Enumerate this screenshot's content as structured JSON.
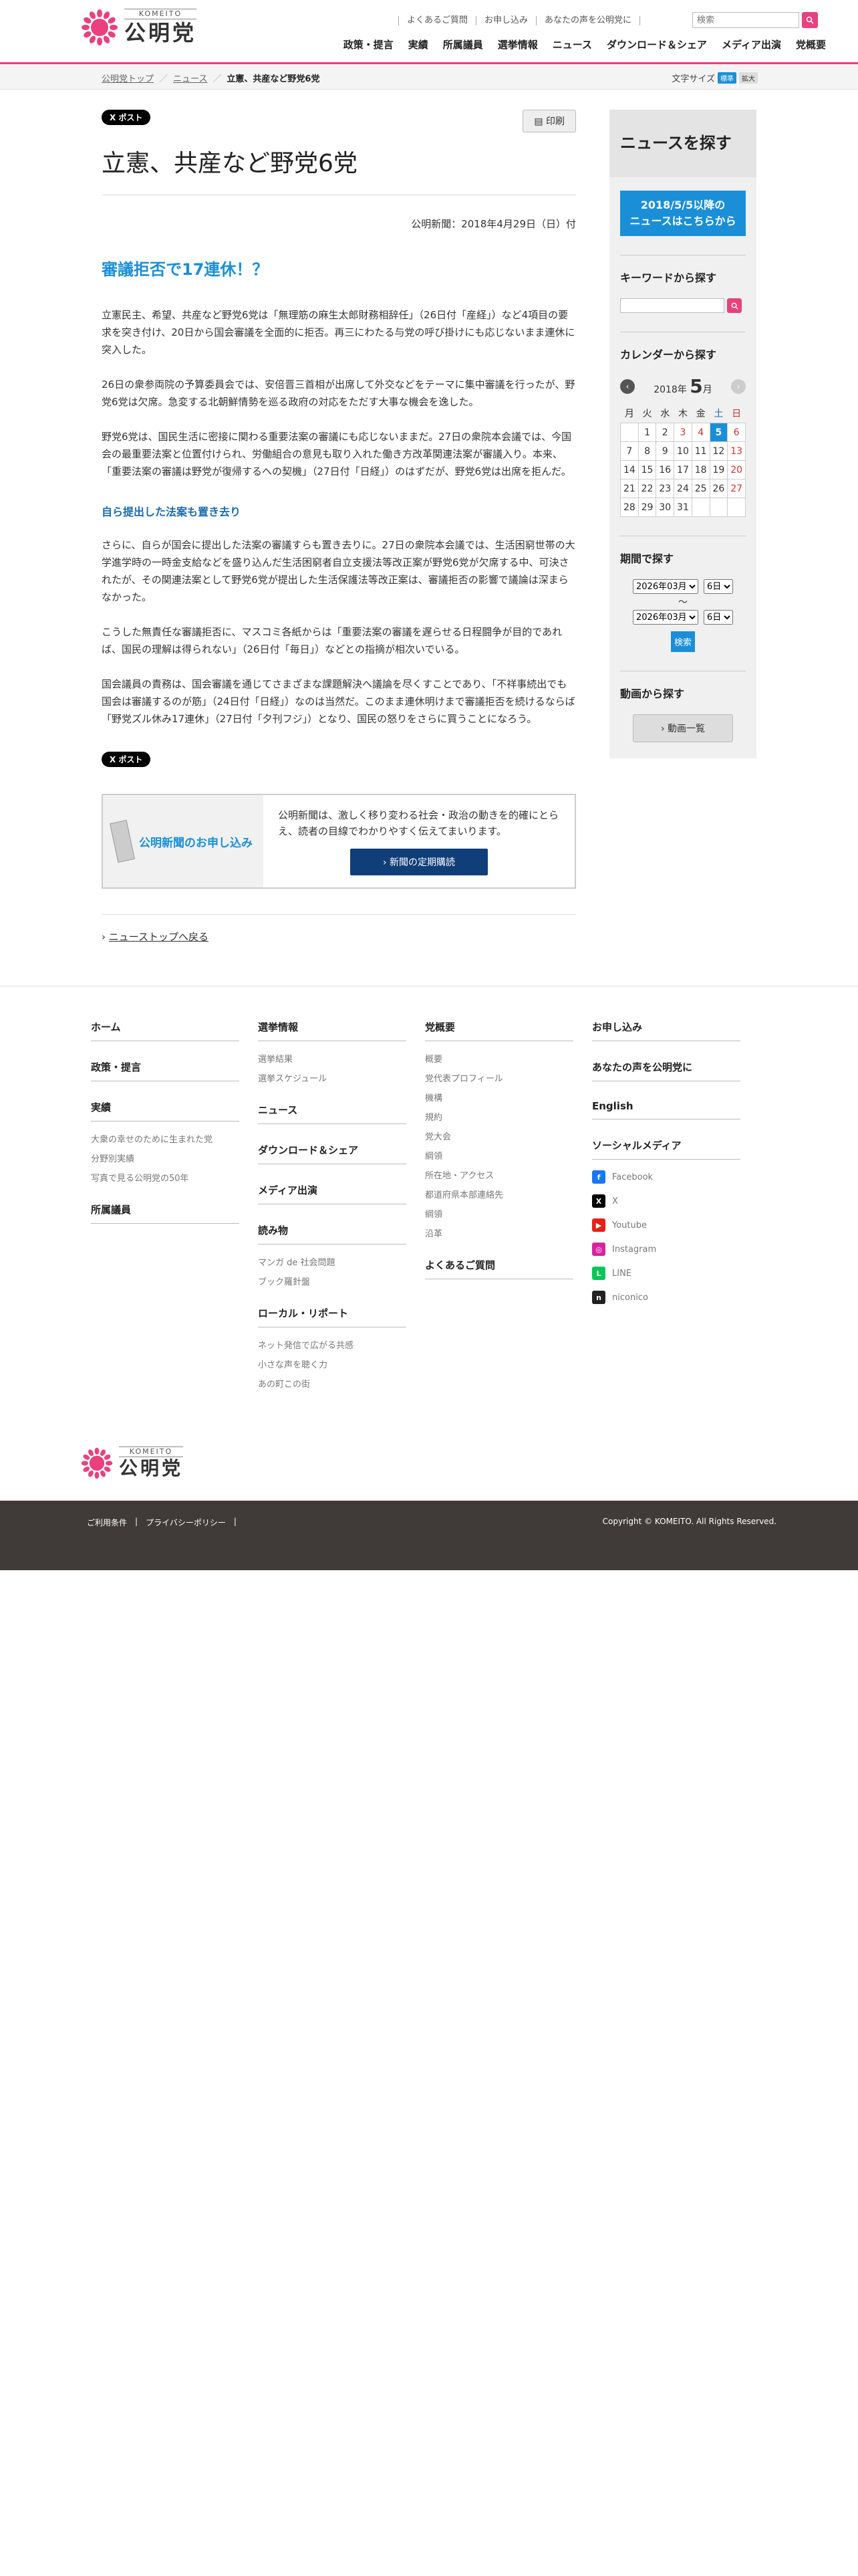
{
  "header": {
    "logo_sub": "KOMEITO",
    "logo_main": "公明党",
    "util_links": [
      "よくあるご質問",
      "お申し込み",
      "あなたの声を公明党に"
    ],
    "search_placeholder": "検索",
    "nav": [
      "政策・提言",
      "実績",
      "所属議員",
      "選挙情報",
      "ニュース",
      "ダウンロード＆シェア",
      "メディア出演",
      "党概要"
    ]
  },
  "breadcrumb": {
    "items": [
      "公明党トップ",
      "ニュース"
    ],
    "current": "立憲、共産など野党6党"
  },
  "fontsize": {
    "label": "文字サイズ",
    "normal": "標準",
    "large": "拡大"
  },
  "article": {
    "tweet": "X ポスト",
    "print": "印刷",
    "title": "立憲、共産など野党6党",
    "date": "公明新聞：2018年4月29日（日）付",
    "lead": "審議拒否で17連休！？",
    "p1": "立憲民主、希望、共産など野党6党は「無理筋の麻生太郎財務相辞任」（26日付「産経」）など4項目の要求を突き付け、20日から国会審議を全面的に拒否。再三にわたる与党の呼び掛けにも応じないまま連休に突入した。",
    "p2": "26日の衆参両院の予算委員会では、安倍晋三首相が出席して外交などをテーマに集中審議を行ったが、野党6党は欠席。急変する北朝鮮情勢を巡る政府の対応をただす大事な機会を逸した。",
    "p3": "野党6党は、国民生活に密接に関わる重要法案の審議にも応じないままだ。27日の衆院本会議では、今国会の最重要法案と位置付けられ、労働組合の意見も取り入れた働き方改革関連法案が審議入り。本来、「重要法案の審議は野党が復帰するへの契機」（27日付「日経」）のはずだが、野党6党は出席を拒んだ。",
    "subhead": "自ら提出した法案も置き去り",
    "p4": "さらに、自らが国会に提出した法案の審議すらも置き去りに。27日の衆院本会議では、生活困窮世帯の大学進学時の一時金支給などを盛り込んだ生活困窮者自立支援法等改正案が野党6党が欠席する中、可決されたが、その関連法案として野党6党が提出した生活保護法等改正案は、審議拒否の影響で議論は深まらなかった。",
    "p5": "こうした無責任な審議拒否に、マスコミ各紙からは「重要法案の審議を遅らせる日程闘争が目的であれば、国民の理解は得られない」（26日付「毎日」）などとの指摘が相次いでいる。",
    "p6": "国会議員の責務は、国会審議を通じてさまざまな課題解決へ議論を尽くすことであり、「不祥事続出でも国会は審議するのが筋」（24日付「日経」）なのは当然だ。このまま連休明けまで審議拒否を続けるならば「野党ズル休み17連休」（27日付「夕刊フジ」）となり、国民の怒りをさらに買うことになろう。",
    "tweet2": "X ポスト",
    "sub_title": "公明新聞のお申し込み",
    "sub_text": "公明新聞は、激しく移り変わる社会・政治の動きを的確にとらえ、読者の目線でわかりやすく伝えてまいります。",
    "sub_button": "新聞の定期購読",
    "back": "ニューストップへ戻る"
  },
  "sidebar": {
    "title": "ニュースを探す",
    "blue_btn_line1": "2018/5/5以降の",
    "blue_btn_line2": "ニュースはこちらから",
    "keyword_title": "キーワードから探す",
    "calendar_title": "カレンダーから探す",
    "cal_year": "2018年",
    "cal_month": "5",
    "cal_month_suffix": "月",
    "weekdays": [
      "月",
      "火",
      "水",
      "木",
      "金",
      "土",
      "日"
    ],
    "weeks": [
      [
        "",
        "1",
        "2",
        "3",
        "4",
        "5",
        "6"
      ],
      [
        "7",
        "8",
        "9",
        "10",
        "11",
        "12",
        "13"
      ],
      [
        "14",
        "15",
        "16",
        "17",
        "18",
        "19",
        "20"
      ],
      [
        "21",
        "22",
        "23",
        "24",
        "25",
        "26",
        "27"
      ],
      [
        "28",
        "29",
        "30",
        "31",
        "",
        "",
        ""
      ]
    ],
    "period_title": "期間で探す",
    "period_year": "2026年03月",
    "period_day": "6日",
    "tilde": "〜",
    "period_btn": "検索",
    "video_title": "動画から探す",
    "video_btn": "動画一覧"
  },
  "footer": {
    "col1": [
      {
        "h": "ホーム",
        "items": []
      },
      {
        "h": "政策・提言",
        "items": []
      },
      {
        "h": "実績",
        "items": [
          "大衆の幸せのために生まれた党",
          "分野別実績",
          "写真で見る公明党の50年"
        ]
      },
      {
        "h": "所属議員",
        "items": []
      }
    ],
    "col2": [
      {
        "h": "選挙情報",
        "items": [
          "選挙結果",
          "選挙スケジュール"
        ]
      },
      {
        "h": "ニュース",
        "items": []
      },
      {
        "h": "ダウンロード＆シェア",
        "items": []
      },
      {
        "h": "メディア出演",
        "items": []
      },
      {
        "h": "読み物",
        "items": [
          "マンガ de 社会問題",
          "ブック羅針盤"
        ]
      },
      {
        "h": "ローカル・リポート",
        "items": [
          "ネット発信で広がる共感",
          "小さな声を聴く力",
          "あの町この街"
        ]
      }
    ],
    "col3": [
      {
        "h": "党概要",
        "items": [
          "概要",
          "党代表プロフィール",
          "機構",
          "規約",
          "党大会",
          "綱領",
          "所在地・アクセス",
          "都道府県本部連絡先",
          "綱領",
          "沿革"
        ]
      },
      {
        "h": "よくあるご質問",
        "items": []
      }
    ],
    "col4": [
      {
        "h": "お申し込み",
        "items": []
      },
      {
        "h": "あなたの声を公明党に",
        "items": []
      },
      {
        "h": "English",
        "items": []
      },
      {
        "h": "ソーシャルメディア",
        "items": []
      }
    ],
    "social": [
      {
        "name": "Facebook",
        "color": "#1877f2",
        "glyph": "f"
      },
      {
        "name": "X",
        "color": "#000000",
        "glyph": "X"
      },
      {
        "name": "Youtube",
        "color": "#e62117",
        "glyph": "▶"
      },
      {
        "name": "Instagram",
        "color": "#d6249f",
        "glyph": "◎"
      },
      {
        "name": "LINE",
        "color": "#06c755",
        "glyph": "L"
      },
      {
        "name": "niconico",
        "color": "#222222",
        "glyph": "n"
      }
    ],
    "bar_links": [
      "ご利用条件",
      "|",
      "プライバシーポリシー",
      "|"
    ],
    "copyright": "Copyright © KOMEITO. All Rights Reserved."
  }
}
